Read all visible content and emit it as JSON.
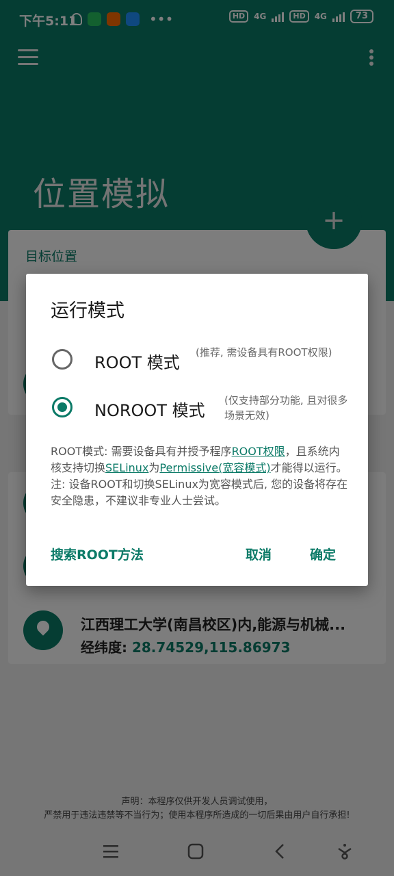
{
  "status_bar": {
    "time": "下午5:11",
    "hd1": "HD",
    "net1": "4G",
    "hd2": "HD",
    "net2": "4G",
    "battery": "73"
  },
  "app": {
    "title": "位置模拟",
    "fab_icon": "+",
    "target_location_label": "目标位置",
    "location_item": {
      "name": "江西理工大学(南昌校区)内,能源与机械...",
      "coord_label": "经纬度:",
      "coord_value": "28.74529,115.86973"
    },
    "disclaimer_line1": "声明：本程序仅供开发人员调试使用，",
    "disclaimer_line2": "严禁用于违法违禁等不当行为；使用本程序所造成的一切后果由用户自行承担!"
  },
  "dialog": {
    "title": "运行模式",
    "options": [
      {
        "label": "ROOT 模式",
        "hint": "(推荐, 需设备具有ROOT权限)",
        "checked": false
      },
      {
        "label": "NOROOT 模式",
        "hint": "(仅支持部分功能, 且对很多场景无效)",
        "checked": true
      }
    ],
    "desc": {
      "p1": "ROOT模式: 需要设备具有并授予程序",
      "link1": "ROOT权限",
      "p2": "，且系统内核支持切换",
      "link2": "SELinux",
      "p3": "为",
      "link3": "Permissive(宽容模式)",
      "p4": "才能得以运行。注: 设备ROOT和切换SELinux为宽容模式后, 您的设备将存在安全隐患，不建议非专业人士尝试。"
    },
    "btn_search": "搜索ROOT方法",
    "btn_cancel": "取消",
    "btn_ok": "确定"
  },
  "colors": {
    "primary": "#0b7a67"
  }
}
